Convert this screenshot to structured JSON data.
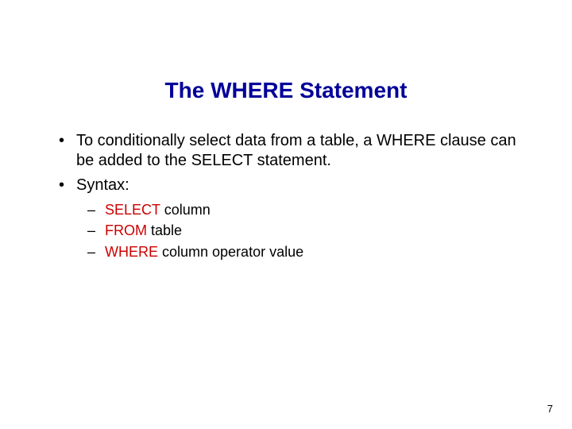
{
  "title": "The WHERE Statement",
  "bullets": {
    "b1": "To conditionally select data from a table, a WHERE clause can be added to the SELECT statement.",
    "b2": "Syntax:"
  },
  "syntax": {
    "l1": {
      "kw": "SELECT",
      "rest": " column"
    },
    "l2": {
      "kw": "FROM",
      "rest": " table"
    },
    "l3": {
      "kw": "WHERE",
      "rest": " column operator value"
    }
  },
  "page_number": "7"
}
